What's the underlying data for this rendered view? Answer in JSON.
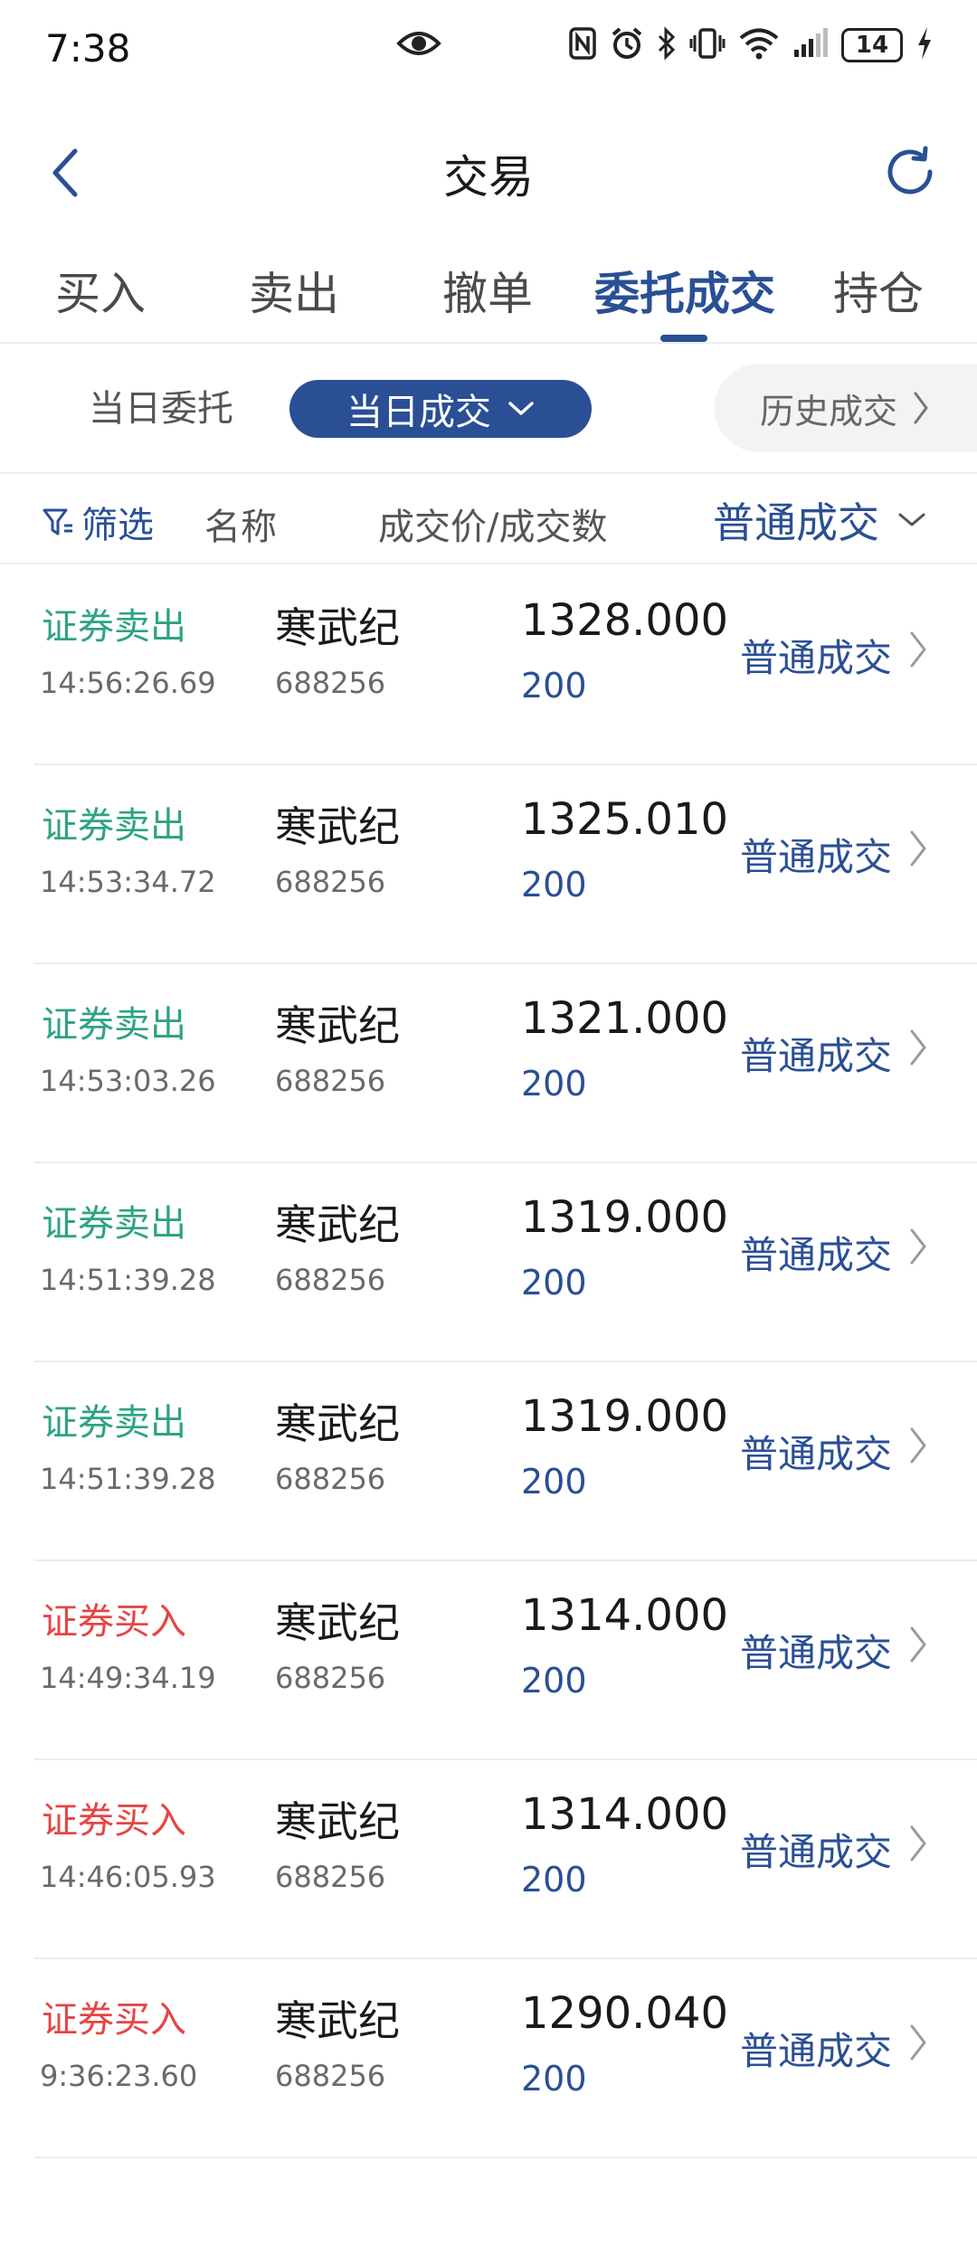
{
  "status_bar": {
    "time": "7:38",
    "battery": "14"
  },
  "header": {
    "title": "交易"
  },
  "main_tabs": [
    {
      "label": "买入"
    },
    {
      "label": "卖出"
    },
    {
      "label": "撤单"
    },
    {
      "label": "委托成交",
      "active": true
    },
    {
      "label": "持仓"
    }
  ],
  "sub_tabs": {
    "today_orders": "当日委托",
    "today_trades": "当日成交",
    "history_trades": "历史成交"
  },
  "list_header": {
    "filter": "筛选",
    "name": "名称",
    "price_qty": "成交价/成交数",
    "type": "普通成交"
  },
  "colors": {
    "accent": "#2a4f95",
    "sell": "#2ea383",
    "buy": "#e54545"
  },
  "rows": [
    {
      "side": "证券卖出",
      "side_type": "sell",
      "time": "14:56:26.69",
      "name": "寒武纪",
      "code": "688256",
      "price": "1328.000",
      "qty": "200",
      "type": "普通成交"
    },
    {
      "side": "证券卖出",
      "side_type": "sell",
      "time": "14:53:34.72",
      "name": "寒武纪",
      "code": "688256",
      "price": "1325.010",
      "qty": "200",
      "type": "普通成交"
    },
    {
      "side": "证券卖出",
      "side_type": "sell",
      "time": "14:53:03.26",
      "name": "寒武纪",
      "code": "688256",
      "price": "1321.000",
      "qty": "200",
      "type": "普通成交"
    },
    {
      "side": "证券卖出",
      "side_type": "sell",
      "time": "14:51:39.28",
      "name": "寒武纪",
      "code": "688256",
      "price": "1319.000",
      "qty": "200",
      "type": "普通成交"
    },
    {
      "side": "证券卖出",
      "side_type": "sell",
      "time": "14:51:39.28",
      "name": "寒武纪",
      "code": "688256",
      "price": "1319.000",
      "qty": "200",
      "type": "普通成交"
    },
    {
      "side": "证券买入",
      "side_type": "buy",
      "time": "14:49:34.19",
      "name": "寒武纪",
      "code": "688256",
      "price": "1314.000",
      "qty": "200",
      "type": "普通成交"
    },
    {
      "side": "证券买入",
      "side_type": "buy",
      "time": "14:46:05.93",
      "name": "寒武纪",
      "code": "688256",
      "price": "1314.000",
      "qty": "200",
      "type": "普通成交"
    },
    {
      "side": "证券买入",
      "side_type": "buy",
      "time": "9:36:23.60",
      "name": "寒武纪",
      "code": "688256",
      "price": "1290.040",
      "qty": "200",
      "type": "普通成交"
    }
  ]
}
